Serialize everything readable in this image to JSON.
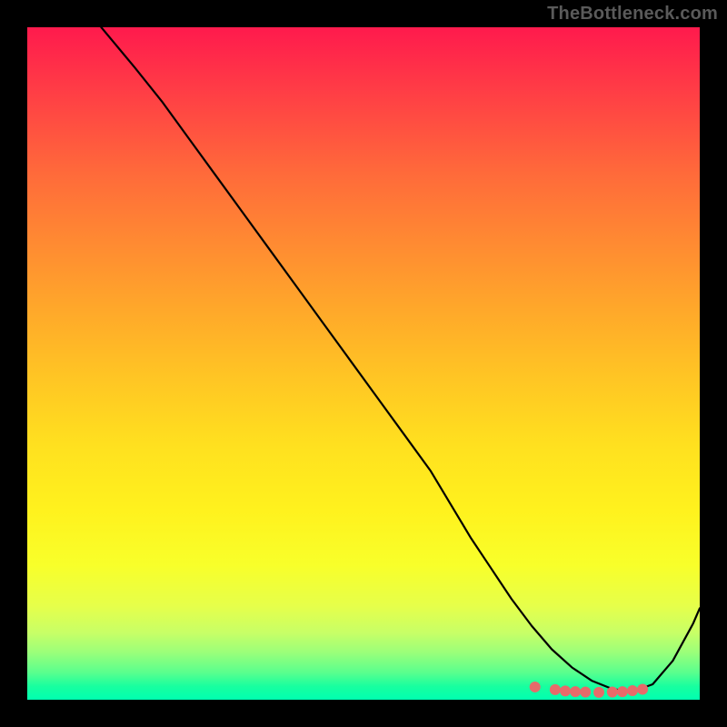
{
  "watermark": "TheBottleneck.com",
  "chart_data": {
    "type": "line",
    "title": "",
    "xlabel": "",
    "ylabel": "",
    "xlim": [
      0,
      100
    ],
    "ylim": [
      0,
      100
    ],
    "series": [
      {
        "name": "bottleneck-curve",
        "x": [
          11,
          16,
          20,
          24,
          28,
          32,
          36,
          40,
          44,
          48,
          52,
          56,
          60,
          63,
          66,
          69,
          72,
          75,
          78,
          81,
          84,
          87,
          90,
          93,
          96,
          99,
          100
        ],
        "values": [
          100,
          94,
          89,
          83.5,
          78,
          72.5,
          67,
          61.5,
          56,
          50.5,
          45,
          39.5,
          34,
          29,
          24,
          19.5,
          15,
          11,
          7.5,
          4.8,
          2.8,
          1.6,
          1.2,
          2.3,
          5.8,
          11.3,
          13.6
        ]
      }
    ],
    "minimum_markers": {
      "x": [
        75.5,
        78.5,
        80,
        81.5,
        83,
        85,
        87,
        88.5,
        90,
        91.5
      ],
      "values": [
        1.9,
        1.5,
        1.3,
        1.2,
        1.15,
        1.1,
        1.15,
        1.2,
        1.35,
        1.55
      ],
      "color": "#e76a6a",
      "radius_px": 6
    },
    "gradient_stops": [
      {
        "pos": 0.0,
        "color": "#ff1a4d"
      },
      {
        "pos": 0.1,
        "color": "#ff3f45"
      },
      {
        "pos": 0.22,
        "color": "#ff6b3a"
      },
      {
        "pos": 0.32,
        "color": "#ff8a32"
      },
      {
        "pos": 0.42,
        "color": "#ffa82a"
      },
      {
        "pos": 0.52,
        "color": "#ffc524"
      },
      {
        "pos": 0.62,
        "color": "#ffe01f"
      },
      {
        "pos": 0.72,
        "color": "#fff21e"
      },
      {
        "pos": 0.8,
        "color": "#f8ff2a"
      },
      {
        "pos": 0.86,
        "color": "#e6ff4a"
      },
      {
        "pos": 0.9,
        "color": "#c8ff66"
      },
      {
        "pos": 0.93,
        "color": "#9aff7a"
      },
      {
        "pos": 0.96,
        "color": "#58ff8e"
      },
      {
        "pos": 0.98,
        "color": "#18ff9f"
      },
      {
        "pos": 1.0,
        "color": "#00ffb0"
      }
    ]
  }
}
